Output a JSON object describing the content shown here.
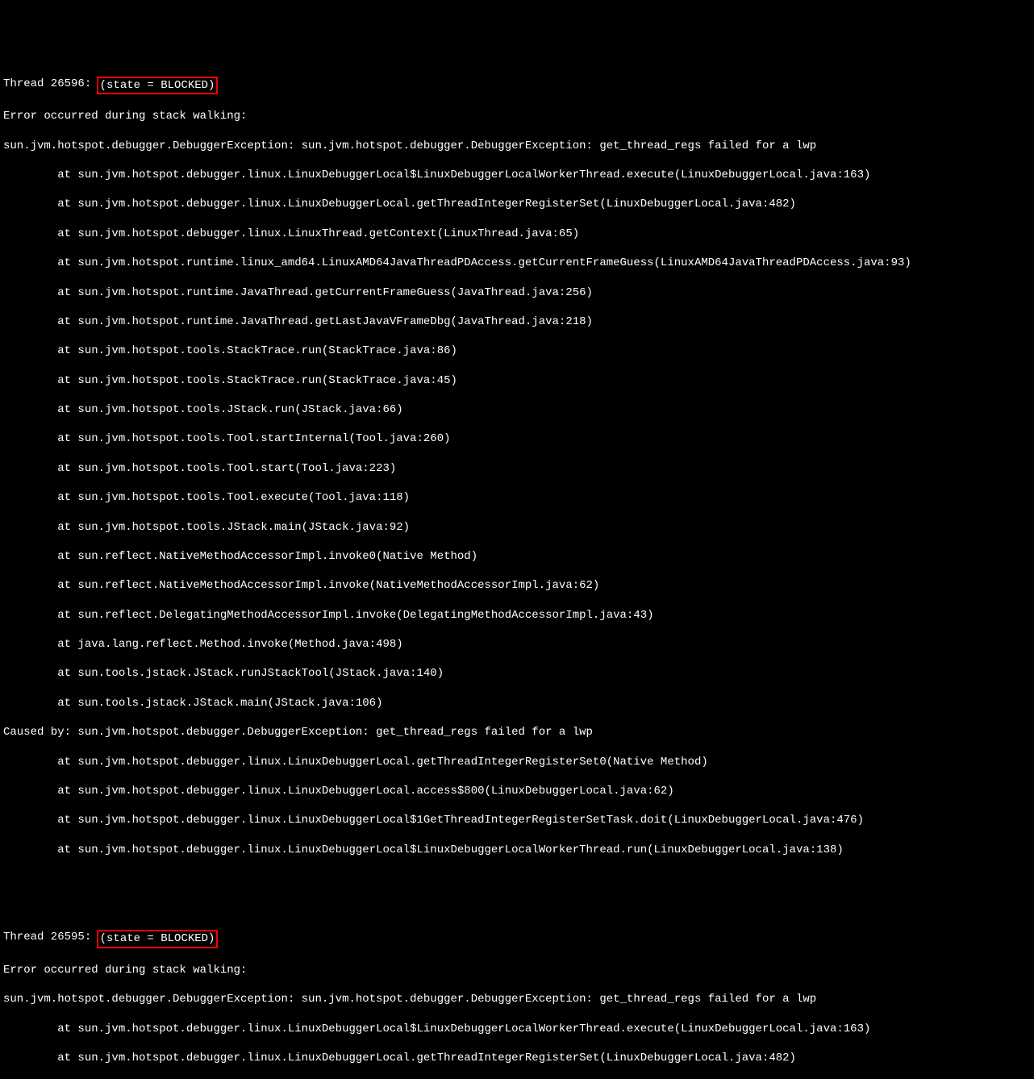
{
  "thread1": {
    "header_prefix": "Thread 26596: ",
    "header_state": "(state = BLOCKED)",
    "error_line": "Error occurred during stack walking:",
    "exception_line": "sun.jvm.hotspot.debugger.DebuggerException: sun.jvm.hotspot.debugger.DebuggerException: get_thread_regs failed for a lwp",
    "stack": [
      "        at sun.jvm.hotspot.debugger.linux.LinuxDebuggerLocal$LinuxDebuggerLocalWorkerThread.execute(LinuxDebuggerLocal.java:163)",
      "        at sun.jvm.hotspot.debugger.linux.LinuxDebuggerLocal.getThreadIntegerRegisterSet(LinuxDebuggerLocal.java:482)",
      "        at sun.jvm.hotspot.debugger.linux.LinuxThread.getContext(LinuxThread.java:65)",
      "        at sun.jvm.hotspot.runtime.linux_amd64.LinuxAMD64JavaThreadPDAccess.getCurrentFrameGuess(LinuxAMD64JavaThreadPDAccess.java:93)",
      "        at sun.jvm.hotspot.runtime.JavaThread.getCurrentFrameGuess(JavaThread.java:256)",
      "        at sun.jvm.hotspot.runtime.JavaThread.getLastJavaVFrameDbg(JavaThread.java:218)",
      "        at sun.jvm.hotspot.tools.StackTrace.run(StackTrace.java:86)",
      "        at sun.jvm.hotspot.tools.StackTrace.run(StackTrace.java:45)",
      "        at sun.jvm.hotspot.tools.JStack.run(JStack.java:66)",
      "        at sun.jvm.hotspot.tools.Tool.startInternal(Tool.java:260)",
      "        at sun.jvm.hotspot.tools.Tool.start(Tool.java:223)",
      "        at sun.jvm.hotspot.tools.Tool.execute(Tool.java:118)",
      "        at sun.jvm.hotspot.tools.JStack.main(JStack.java:92)",
      "        at sun.reflect.NativeMethodAccessorImpl.invoke0(Native Method)",
      "        at sun.reflect.NativeMethodAccessorImpl.invoke(NativeMethodAccessorImpl.java:62)",
      "        at sun.reflect.DelegatingMethodAccessorImpl.invoke(DelegatingMethodAccessorImpl.java:43)",
      "        at java.lang.reflect.Method.invoke(Method.java:498)",
      "        at sun.tools.jstack.JStack.runJStackTool(JStack.java:140)",
      "        at sun.tools.jstack.JStack.main(JStack.java:106)"
    ],
    "caused_by": "Caused by: sun.jvm.hotspot.debugger.DebuggerException: get_thread_regs failed for a lwp",
    "caused_stack": [
      "        at sun.jvm.hotspot.debugger.linux.LinuxDebuggerLocal.getThreadIntegerRegisterSet0(Native Method)",
      "        at sun.jvm.hotspot.debugger.linux.LinuxDebuggerLocal.access$800(LinuxDebuggerLocal.java:62)",
      "        at sun.jvm.hotspot.debugger.linux.LinuxDebuggerLocal$1GetThreadIntegerRegisterSetTask.doit(LinuxDebuggerLocal.java:476)",
      "        at sun.jvm.hotspot.debugger.linux.LinuxDebuggerLocal$LinuxDebuggerLocalWorkerThread.run(LinuxDebuggerLocal.java:138)"
    ]
  },
  "thread2": {
    "header_prefix": "Thread 26595: ",
    "header_state": "(state = BLOCKED)",
    "error_line": "Error occurred during stack walking:",
    "exception_line": "sun.jvm.hotspot.debugger.DebuggerException: sun.jvm.hotspot.debugger.DebuggerException: get_thread_regs failed for a lwp",
    "stack": [
      "        at sun.jvm.hotspot.debugger.linux.LinuxDebuggerLocal$LinuxDebuggerLocalWorkerThread.execute(LinuxDebuggerLocal.java:163)",
      "        at sun.jvm.hotspot.debugger.linux.LinuxDebuggerLocal.getThreadIntegerRegisterSet(LinuxDebuggerLocal.java:482)"
    ]
  }
}
